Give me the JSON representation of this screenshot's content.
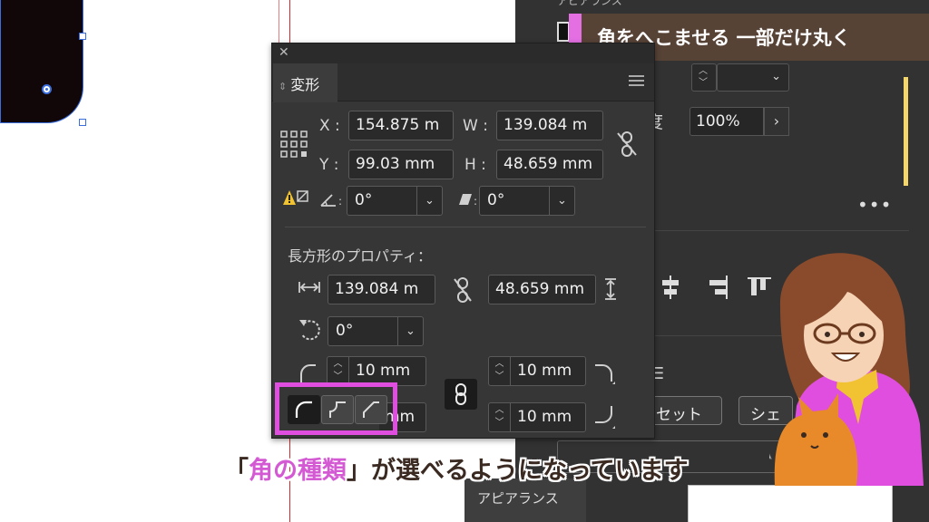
{
  "dock": {
    "top_label": "アピアランス",
    "opacity_label": "度",
    "opacity_value": "100%",
    "more_icon": "more-dots-icon",
    "reset_button": "セット",
    "she_button": "シェ",
    "appearance_tab": "アピアランス"
  },
  "caption_top": "角をへこませる 一部だけ丸く",
  "transform_panel": {
    "close": "✕",
    "tab_title": "変形",
    "x_label": "X :",
    "x_value": "154.875 m",
    "y_label": "Y :",
    "y_value": "99.03 mm",
    "w_label": "W :",
    "w_value": "139.084 m",
    "h_label": "H :",
    "h_value": "48.659 mm",
    "angle_value": "0°",
    "shear_value": "0°",
    "section_title": "長方形のプロパティ：",
    "rect_width": "139.084 m",
    "rect_height": "48.659 mm",
    "rotation_value": "0°",
    "corner_tl": "10 mm",
    "corner_tr": "10 mm",
    "corner_bl": "mm",
    "corner_br": "10 mm"
  },
  "subtitle": {
    "bracket_open": "「",
    "highlight": "角の種類",
    "bracket_close": "」",
    "rest": "が選べるようになっています"
  },
  "colors": {
    "accent_pink": "#e04ee0",
    "caption_brown": "#574236",
    "panel_bg": "#363636"
  }
}
